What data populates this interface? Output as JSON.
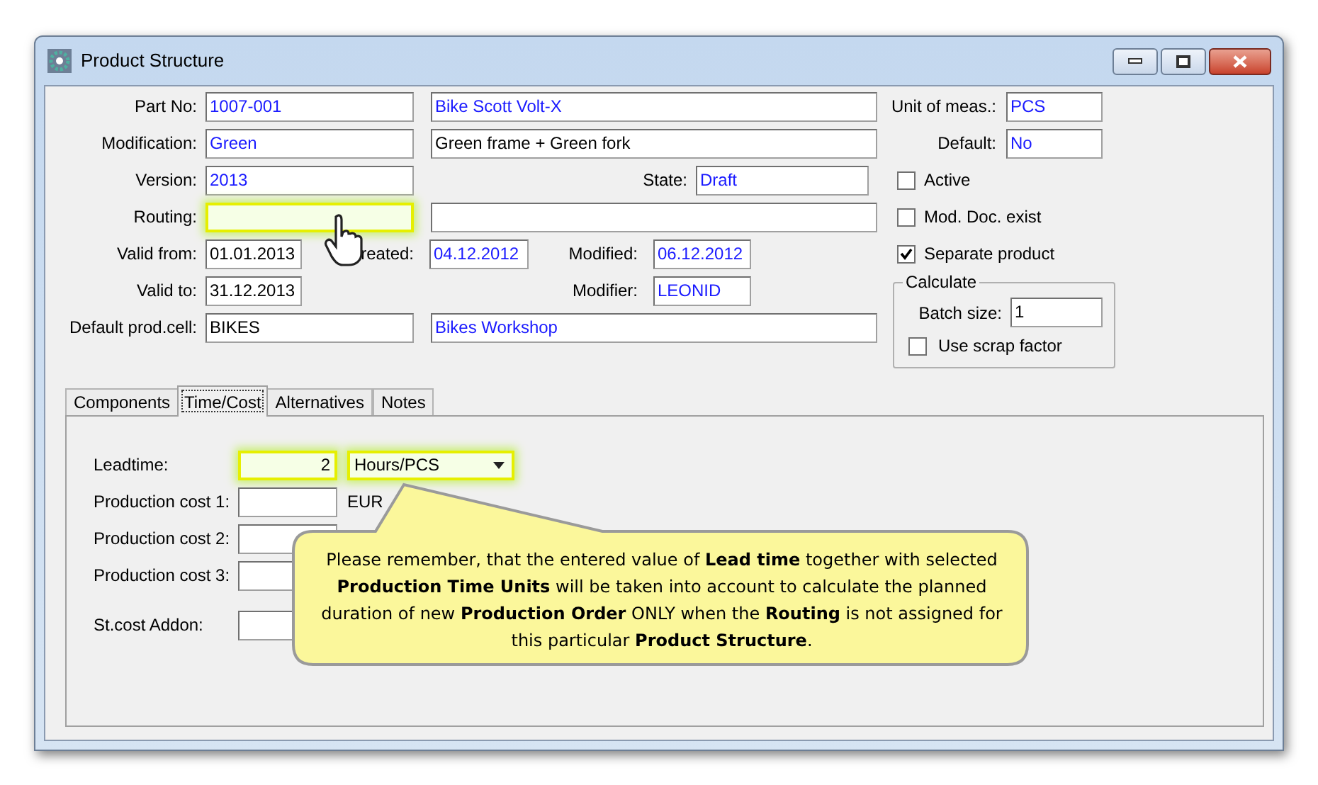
{
  "window": {
    "title": "Product Structure"
  },
  "header": {
    "part_no": {
      "label": "Part No:",
      "code": "1007-001",
      "name": "Bike Scott Volt-X"
    },
    "modification": {
      "label": "Modification:",
      "code": "Green",
      "description": "Green frame + Green fork"
    },
    "version": {
      "label": "Version:",
      "value": "2013"
    },
    "state": {
      "label": "State:",
      "value": "Draft"
    },
    "routing": {
      "label": "Routing:",
      "highlighted": true
    },
    "valid_from": {
      "label": "Valid from:",
      "value": "01.01.2013"
    },
    "created": {
      "label": "reated:",
      "value": "04.12.2012"
    },
    "modified": {
      "label": "Modified:",
      "value": "06.12.2012"
    },
    "valid_to": {
      "label": "Valid to:",
      "value": "31.12.2013"
    },
    "modifier": {
      "label": "Modifier:",
      "value": "LEONID"
    },
    "default_prod_cell": {
      "label": "Default prod.cell:",
      "code": "BIKES",
      "name": "Bikes Workshop"
    },
    "unit_of_meas": {
      "label": "Unit of meas.:",
      "value": "PCS"
    },
    "default": {
      "label": "Default:",
      "value": "No"
    }
  },
  "checkboxes": [
    {
      "label": "Active",
      "checked": false
    },
    {
      "label": "Mod. Doc. exist",
      "checked": false
    },
    {
      "label": "Separate product",
      "checked": true
    }
  ],
  "calculate": {
    "title": "Calculate",
    "batch_size": {
      "label": "Batch size:",
      "value": "1"
    },
    "use_scrap_factor": {
      "label": "Use scrap factor",
      "checked": false
    }
  },
  "tabs": [
    {
      "label": "Components",
      "selected": false
    },
    {
      "label": "Time/Cost",
      "selected": true
    },
    {
      "label": "Alternatives",
      "selected": false
    },
    {
      "label": "Notes",
      "selected": false
    }
  ],
  "time_cost": {
    "leadtime": {
      "label": "Leadtime:",
      "value": "2",
      "highlighted": true
    },
    "time_units": {
      "value": "Hours/PCS",
      "highlighted": true
    },
    "costs": [
      {
        "label": "Production cost 1:",
        "currency": "EUR"
      },
      {
        "label": "Production cost 2:"
      },
      {
        "label": "Production cost 3:"
      }
    ],
    "st_cost_addon": {
      "label": "St.cost Addon:"
    }
  },
  "callout": {
    "text": "Please remember, that the entered value of **Lead time** together with selected **Production Time Units** will be taken into account to calculate the planned duration of new **Production Order** ONLY when the **Routing** is not assigned for this particular **Product Structure**."
  }
}
